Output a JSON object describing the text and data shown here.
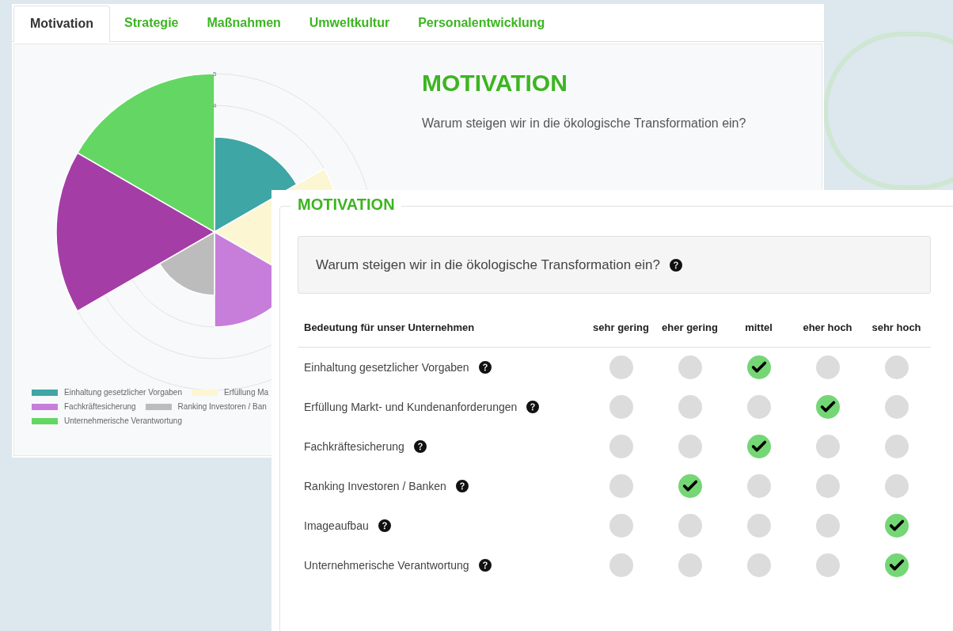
{
  "tabs": [
    {
      "label": "Motivation",
      "selected": true
    },
    {
      "label": "Strategie",
      "selected": false
    },
    {
      "label": "Maßnahmen",
      "selected": false
    },
    {
      "label": "Umweltkultur",
      "selected": false
    },
    {
      "label": "Personalentwicklung",
      "selected": false
    }
  ],
  "chart": {
    "sectors": [
      {
        "color": "#3fa6a6"
      },
      {
        "color": "#fdf6d3"
      },
      {
        "color": "#c77edb"
      },
      {
        "color": "#bcbcbc"
      },
      {
        "color": "#a53da6"
      },
      {
        "color": "#64d664"
      }
    ],
    "scale_labels": [
      "5",
      "4"
    ],
    "legend": [
      {
        "label": "Einhaltung gesetzlicher Vorgaben",
        "color": "#3fa6a6"
      },
      {
        "label": "Erfüllung Ma",
        "color": "#fdf6d3"
      },
      {
        "label": "Fachkräftesicherung",
        "color": "#c77edb"
      },
      {
        "label": "Ranking Investoren / Ban",
        "color": "#bcbcbc"
      },
      {
        "label": "Unternehmerische Verantwortung",
        "color": "#64d664"
      }
    ]
  },
  "intro": {
    "heading": "MOTIVATION",
    "text": "Warum steigen wir in die ökologische Transformation ein?"
  },
  "panel": {
    "legend": "MOTIVATION",
    "question": "Warum steigen wir in die ökologische Transformation ein?",
    "columns": [
      "Bedeutung für unser Unternehmen",
      "sehr gering",
      "eher gering",
      "mittel",
      "eher hoch",
      "sehr hoch"
    ],
    "rows": [
      {
        "label": "Einhaltung gesetzlicher Vorgaben",
        "ratings": [
          {
            "selected": false
          },
          {
            "selected": false
          },
          {
            "selected": true
          },
          {
            "selected": false
          },
          {
            "selected": false
          }
        ]
      },
      {
        "label": "Erfüllung Markt- und Kundenanforderungen",
        "ratings": [
          {
            "selected": false
          },
          {
            "selected": false
          },
          {
            "selected": false
          },
          {
            "selected": true
          },
          {
            "selected": false
          }
        ]
      },
      {
        "label": "Fachkräftesicherung",
        "ratings": [
          {
            "selected": false
          },
          {
            "selected": false
          },
          {
            "selected": true
          },
          {
            "selected": false
          },
          {
            "selected": false
          }
        ]
      },
      {
        "label": "Ranking Investoren / Banken",
        "ratings": [
          {
            "selected": false
          },
          {
            "selected": true
          },
          {
            "selected": false
          },
          {
            "selected": false
          },
          {
            "selected": false
          }
        ]
      },
      {
        "label": "Imageaufbau",
        "ratings": [
          {
            "selected": false
          },
          {
            "selected": false
          },
          {
            "selected": false
          },
          {
            "selected": false
          },
          {
            "selected": true
          }
        ]
      },
      {
        "label": "Unternehmerische Verantwortung",
        "ratings": [
          {
            "selected": false
          },
          {
            "selected": false
          },
          {
            "selected": false
          },
          {
            "selected": false
          },
          {
            "selected": true
          }
        ]
      }
    ]
  }
}
